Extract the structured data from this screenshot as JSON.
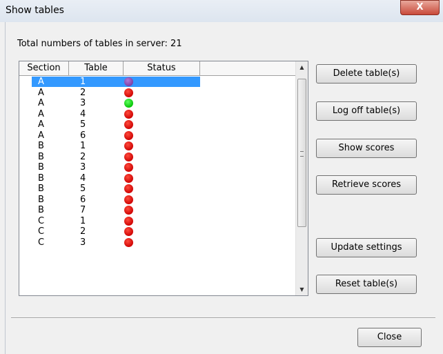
{
  "window": {
    "title": "Show tables",
    "close_glyph": "X"
  },
  "summary": {
    "label": "Total numbers of tables in server: 21"
  },
  "grid": {
    "columns": [
      "Section",
      "Table",
      "Status"
    ],
    "rows": [
      {
        "section": "A",
        "table": "1",
        "status": "purple",
        "selected": true
      },
      {
        "section": "A",
        "table": "2",
        "status": "red"
      },
      {
        "section": "A",
        "table": "3",
        "status": "green"
      },
      {
        "section": "A",
        "table": "4",
        "status": "red"
      },
      {
        "section": "A",
        "table": "5",
        "status": "red"
      },
      {
        "section": "A",
        "table": "6",
        "status": "red"
      },
      {
        "section": "B",
        "table": "1",
        "status": "red"
      },
      {
        "section": "B",
        "table": "2",
        "status": "red"
      },
      {
        "section": "B",
        "table": "3",
        "status": "red"
      },
      {
        "section": "B",
        "table": "4",
        "status": "red"
      },
      {
        "section": "B",
        "table": "5",
        "status": "red"
      },
      {
        "section": "B",
        "table": "6",
        "status": "red"
      },
      {
        "section": "B",
        "table": "7",
        "status": "red"
      },
      {
        "section": "C",
        "table": "1",
        "status": "red"
      },
      {
        "section": "C",
        "table": "2",
        "status": "red"
      },
      {
        "section": "C",
        "table": "3",
        "status": "red"
      }
    ]
  },
  "buttons": {
    "delete": "Delete table(s)",
    "logoff": "Log off table(s)",
    "show_scores": "Show scores",
    "retrieve_scores": "Retrieve scores",
    "update_settings": "Update settings",
    "reset": "Reset table(s)",
    "close": "Close"
  },
  "colors": {
    "red": "#e00000",
    "green": "#00cc00",
    "purple": "#8a4cb8",
    "selection": "#3399ff"
  }
}
